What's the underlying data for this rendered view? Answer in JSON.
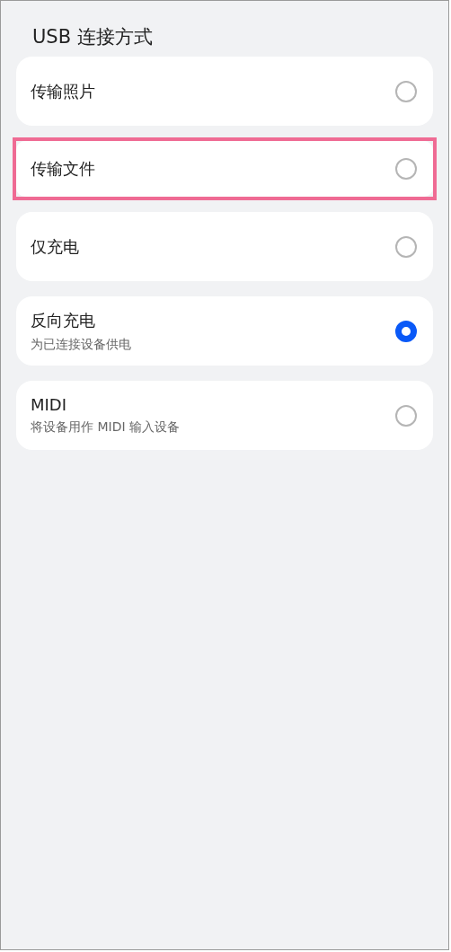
{
  "title": "USB 连接方式",
  "options": [
    {
      "label": "传输照片",
      "selected": false,
      "highlighted": false
    },
    {
      "label": "传输文件",
      "selected": false,
      "highlighted": true
    },
    {
      "label": "仅充电",
      "selected": false,
      "highlighted": false
    },
    {
      "label": "反向充电",
      "description": "为已连接设备供电",
      "selected": true,
      "highlighted": false
    },
    {
      "label": "MIDI",
      "description": "将设备用作 MIDI 输入设备",
      "selected": false,
      "highlighted": false
    }
  ]
}
